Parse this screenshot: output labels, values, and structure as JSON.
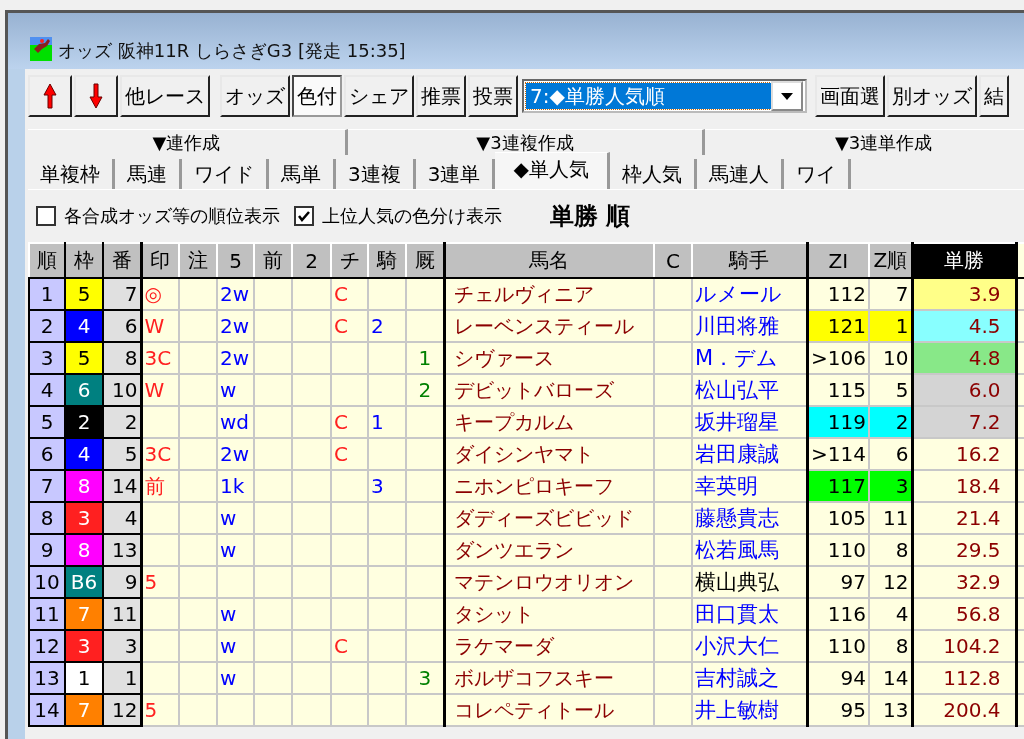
{
  "window": {
    "title": "オッズ 阪神11R しらさぎG3  [発走 15:35]"
  },
  "toolbar": {
    "buttons": [
      {
        "kind": "up",
        "selected": false
      },
      {
        "kind": "down",
        "selected": false
      },
      {
        "kind": "text",
        "label": "他レース",
        "selected": false
      },
      {
        "kind": "text",
        "label": "オッズ",
        "selected": false
      },
      {
        "kind": "text",
        "label": "色付",
        "selected": true
      },
      {
        "kind": "text",
        "label": "シェア",
        "selected": false
      },
      {
        "kind": "text",
        "label": "推票",
        "selected": false
      },
      {
        "kind": "text",
        "label": "投票",
        "selected": false
      }
    ],
    "dropdown": {
      "value": "7:◆単勝人気順"
    },
    "right_buttons": [
      {
        "label": "画面選"
      },
      {
        "label": "別オッズ"
      },
      {
        "label": "結"
      }
    ]
  },
  "tab_groups": [
    "▼連作成",
    "▼3連複作成",
    "▼3連単作成"
  ],
  "tabs": [
    {
      "label": "単複枠",
      "selected": false
    },
    {
      "label": "馬連",
      "selected": false
    },
    {
      "label": "ワイド",
      "selected": false
    },
    {
      "label": "馬単",
      "selected": false
    },
    {
      "label": "3連複",
      "selected": false
    },
    {
      "label": "3連単",
      "selected": false
    },
    {
      "label": "◆単人気",
      "selected": true
    },
    {
      "label": "枠人気",
      "selected": false
    },
    {
      "label": "馬連人",
      "selected": false
    },
    {
      "label": "ワイ",
      "selected": false
    }
  ],
  "options": [
    {
      "label": "各合成オッズ等の順位表示",
      "checked": false
    },
    {
      "label": "上位人気の色分け表示",
      "checked": true
    }
  ],
  "heading": "単勝 順",
  "table": {
    "columns": [
      {
        "label": "順",
        "selected": false
      },
      {
        "label": "枠",
        "selected": false
      },
      {
        "label": "番",
        "selected": false
      },
      {
        "label": "印",
        "selected": false
      },
      {
        "label": "注",
        "selected": false
      },
      {
        "label": "5",
        "selected": false
      },
      {
        "label": "前",
        "selected": false
      },
      {
        "label": "2",
        "selected": false
      },
      {
        "label": "チ",
        "selected": false
      },
      {
        "label": "騎",
        "selected": false
      },
      {
        "label": "厩",
        "selected": false
      },
      {
        "label": "馬名",
        "selected": false
      },
      {
        "label": "C",
        "selected": false
      },
      {
        "label": "騎手",
        "selected": false
      },
      {
        "label": "ZI",
        "selected": false
      },
      {
        "label": "Z順",
        "selected": false
      },
      {
        "label": "単勝",
        "selected": true
      }
    ],
    "rows": [
      {
        "rank": "1",
        "waku": {
          "text": "5",
          "color": "#ffff00"
        },
        "number": "7",
        "mark": "◎",
        "col_5": "2w",
        "chi": "C",
        "horse": "チェルヴィニア",
        "jockey": {
          "text": "ルメール",
          "color": "#0000ff"
        },
        "zi": {
          "value": "112",
          "rank": "7"
        },
        "odds": {
          "text": "3.9",
          "color": "#ffff88"
        }
      },
      {
        "rank": "2",
        "waku": {
          "text": "4",
          "color": "#0000ff"
        },
        "number": "6",
        "mark": "W",
        "col_5": "2w",
        "chi": "C",
        "ki": "2",
        "horse": "レーベンスティール",
        "jockey": {
          "text": "川田将雅",
          "color": "#0000ff"
        },
        "zi": {
          "value": "121",
          "rank": "1",
          "color": "#ffff00"
        },
        "odds": {
          "text": "4.5",
          "color": "#88ffff"
        }
      },
      {
        "rank": "3",
        "waku": {
          "text": "5",
          "color": "#ffff00"
        },
        "number": "8",
        "mark": "3C",
        "col_5": "2w",
        "kyu": "1",
        "horse": "シヴァース",
        "jockey": {
          "text": "M．デム",
          "color": "#0000ff"
        },
        "zi": {
          "value": ">106",
          "rank": "10"
        },
        "odds": {
          "text": "4.8",
          "color": "#88e888"
        }
      },
      {
        "rank": "4",
        "waku": {
          "text": "6",
          "color": "#008080"
        },
        "number": "10",
        "mark": "W",
        "col_5": "w",
        "kyu": "2",
        "horse": "デビットバローズ",
        "jockey": {
          "text": "松山弘平",
          "color": "#0000ff"
        },
        "zi": {
          "value": "115",
          "rank": "5"
        },
        "odds": {
          "text": "6.0",
          "color": "#d4d4d4"
        }
      },
      {
        "rank": "5",
        "waku": {
          "text": "2",
          "color": "#000000"
        },
        "number": "2",
        "col_5": "wd",
        "chi": "C",
        "ki": "1",
        "horse": "キープカルム",
        "jockey": {
          "text": "坂井瑠星",
          "color": "#0000ff"
        },
        "zi": {
          "value": "119",
          "rank": "2",
          "color": "#00ffff"
        },
        "odds": {
          "text": "7.2",
          "color": "#d4d4d4"
        }
      },
      {
        "rank": "6",
        "waku": {
          "text": "4",
          "color": "#0000ff"
        },
        "number": "5",
        "mark": "3C",
        "col_5": "2w",
        "chi": "C",
        "horse": "ダイシンヤマト",
        "jockey": {
          "text": "岩田康誠",
          "color": "#0000ff"
        },
        "zi": {
          "value": ">114",
          "rank": "6"
        },
        "odds": {
          "text": "16.2"
        }
      },
      {
        "rank": "7",
        "waku": {
          "text": "8",
          "color": "#ff00ff"
        },
        "number": "14",
        "mark": "前",
        "col_5": "1k",
        "ki": "3",
        "horse": "ニホンピロキーフ",
        "jockey": {
          "text": "幸英明",
          "color": "#0000ff"
        },
        "zi": {
          "value": "117",
          "rank": "3",
          "color": "#00ff00"
        },
        "odds": {
          "text": "18.4"
        }
      },
      {
        "rank": "8",
        "waku": {
          "text": "3",
          "color": "#ff2020"
        },
        "number": "4",
        "col_5": "w",
        "horse": "ダディーズビビッド",
        "jockey": {
          "text": "藤懸貴志",
          "color": "#0000ff"
        },
        "zi": {
          "value": "105",
          "rank": "11"
        },
        "odds": {
          "text": "21.4"
        }
      },
      {
        "rank": "9",
        "waku": {
          "text": "8",
          "color": "#ff00ff"
        },
        "number": "13",
        "col_5": "w",
        "horse": "ダンツエラン",
        "jockey": {
          "text": "松若風馬",
          "color": "#0000ff"
        },
        "zi": {
          "value": "110",
          "rank": "8"
        },
        "odds": {
          "text": "29.5"
        }
      },
      {
        "rank": "10",
        "waku": {
          "text": "B6",
          "color": "#008080"
        },
        "number": "9",
        "mark": "5",
        "horse": "マテンロウオリオン",
        "jockey": {
          "text": "横山典弘",
          "color": "#000000"
        },
        "zi": {
          "value": "97",
          "rank": "12"
        },
        "odds": {
          "text": "32.9"
        }
      },
      {
        "rank": "11",
        "waku": {
          "text": "7",
          "color": "#ff8000"
        },
        "number": "11",
        "col_5": "w",
        "horse": "タシット",
        "jockey": {
          "text": "田口貫太",
          "color": "#0000ff"
        },
        "zi": {
          "value": "116",
          "rank": "4"
        },
        "odds": {
          "text": "56.8"
        }
      },
      {
        "rank": "12",
        "waku": {
          "text": "3",
          "color": "#ff2020"
        },
        "number": "3",
        "col_5": "w",
        "chi": "C",
        "horse": "ラケマーダ",
        "jockey": {
          "text": "小沢大仁",
          "color": "#0000ff"
        },
        "zi": {
          "value": "110",
          "rank": "8"
        },
        "odds": {
          "text": "104.2"
        }
      },
      {
        "rank": "13",
        "waku": {
          "text": "1",
          "color": "#ffffff"
        },
        "number": "1",
        "col_5": "w",
        "kyu": "3",
        "horse": "ボルザコフスキー",
        "jockey": {
          "text": "吉村誠之",
          "color": "#0000ff"
        },
        "zi": {
          "value": "94",
          "rank": "14"
        },
        "odds": {
          "text": "112.8"
        }
      },
      {
        "rank": "14",
        "waku": {
          "text": "7",
          "color": "#ff8000"
        },
        "number": "12",
        "mark": "5",
        "horse": "コレペティトール",
        "jockey": {
          "text": "井上敏樹",
          "color": "#0000ff"
        },
        "zi": {
          "value": "95",
          "rank": "13"
        },
        "odds": {
          "text": "200.4"
        }
      }
    ]
  }
}
